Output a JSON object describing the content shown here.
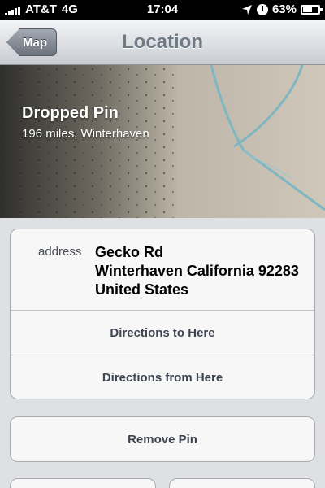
{
  "status_bar": {
    "carrier": "AT&T",
    "network": "4G",
    "time": "17:04",
    "battery": "63%",
    "battery_level": 0.63,
    "icons": [
      "signal-icon",
      "location-arrow-icon",
      "clock-icon",
      "battery-icon"
    ]
  },
  "nav": {
    "back_label": "Map",
    "title": "Location"
  },
  "header": {
    "title": "Dropped Pin",
    "subtitle": "196 miles, Winterhaven"
  },
  "address": {
    "label": "address",
    "lines": [
      "Gecko Rd",
      "Winterhaven California 92283",
      "United States"
    ]
  },
  "actions": {
    "directions_to": "Directions to Here",
    "directions_from": "Directions from Here",
    "remove_pin": "Remove Pin"
  },
  "colors": {
    "nav_title": "#707a85",
    "back_button": "#6c737d",
    "cell_text": "#3e4550",
    "background": "#dfe0e4"
  }
}
